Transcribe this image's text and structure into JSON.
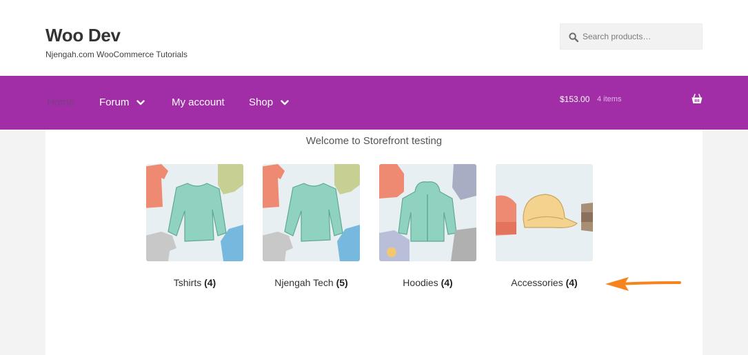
{
  "header": {
    "site_title": "Woo Dev",
    "site_description": "Njengah.com WooCommerce Tutorials",
    "search": {
      "placeholder": "Search products…",
      "icon": "search-icon"
    }
  },
  "nav": {
    "background": "#a12ea6",
    "items": [
      {
        "label": "Home",
        "active": true
      },
      {
        "label": "Forum",
        "dropdown": true
      },
      {
        "label": "My account"
      },
      {
        "label": "Shop",
        "dropdown": true
      }
    ]
  },
  "cart": {
    "amount": "$153.00",
    "count": "4 items",
    "icon": "basket-icon"
  },
  "main": {
    "welcome": "Welcome to Storefront testing",
    "categories": [
      {
        "name": "Tshirts",
        "count": "(4)"
      },
      {
        "name": "Njengah Tech",
        "count": "(5)"
      },
      {
        "name": "Hoodies",
        "count": "(4)"
      },
      {
        "name": "Accessories",
        "count": "(4)"
      }
    ]
  },
  "annotation": {
    "arrow_color": "#f7831f"
  }
}
